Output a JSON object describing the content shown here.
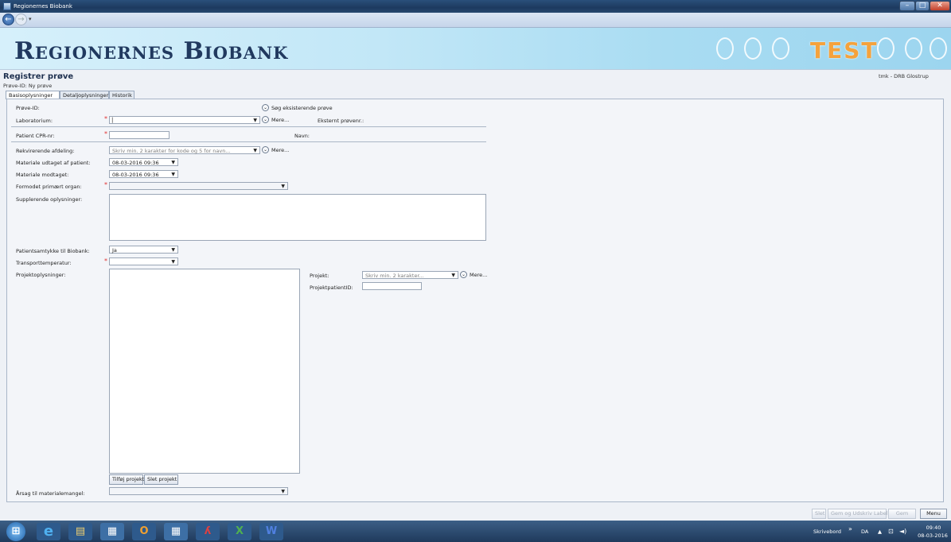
{
  "window": {
    "title": "Regionernes Biobank"
  },
  "banner": {
    "brand": "Regionernes Biobank",
    "test_label": "TEST"
  },
  "page": {
    "title": "Registrer prøve",
    "subtitle": "Prøve-ID: Ny prøve",
    "user": "tmk - DRB Glostrup"
  },
  "tabs": [
    "Basisoplysninger",
    "Detaljoplysninger",
    "Historik"
  ],
  "form": {
    "prove_id_label": "Prøve-ID:",
    "search_existing": "Søg eksisterende prøve",
    "laboratorium_label": "Laboratorium:",
    "mere": "Mere...",
    "eksternt_label": "Eksternt prøvenr.:",
    "cpr_label": "Patient CPR-nr:",
    "navn_label": "Navn:",
    "rekv_label": "Rekvirerende afdeling:",
    "rekv_placeholder": "Skriv min. 2 karakter for kode og 5 for navn...",
    "udtaget_label": "Materiale udtaget af patient:",
    "udtaget_value": "08-03-2016 09:36",
    "modtaget_label": "Materiale modtaget:",
    "modtaget_value": "08-03-2016 09:36",
    "organ_label": "Formodet primært organ:",
    "suppl_label": "Supplerende oplysninger:",
    "samtykke_label": "Patientsamtykke til Biobank:",
    "samtykke_value": "Ja",
    "transport_label": "Transporttemperatur:",
    "projekt_opl_label": "Projektoplysninger:",
    "projekt_label": "Projekt:",
    "projekt_placeholder": "Skriv min. 2 karakter...",
    "projektpatient_label": "ProjektpatientID:",
    "tilfoj_projekt": "Tilføj projekt",
    "slet_projekt": "Slet projekt",
    "aarsag_label": "Årsag til materialemangel:"
  },
  "footer": {
    "slet": "Slet",
    "gem_udskriv": "Gem og Udskriv Labels",
    "gem": "Gem",
    "menu": "Menu"
  },
  "taskbar": {
    "skrivebord": "Skrivebord",
    "lang": "DA",
    "time": "09:40",
    "date": "08-03-2016"
  }
}
